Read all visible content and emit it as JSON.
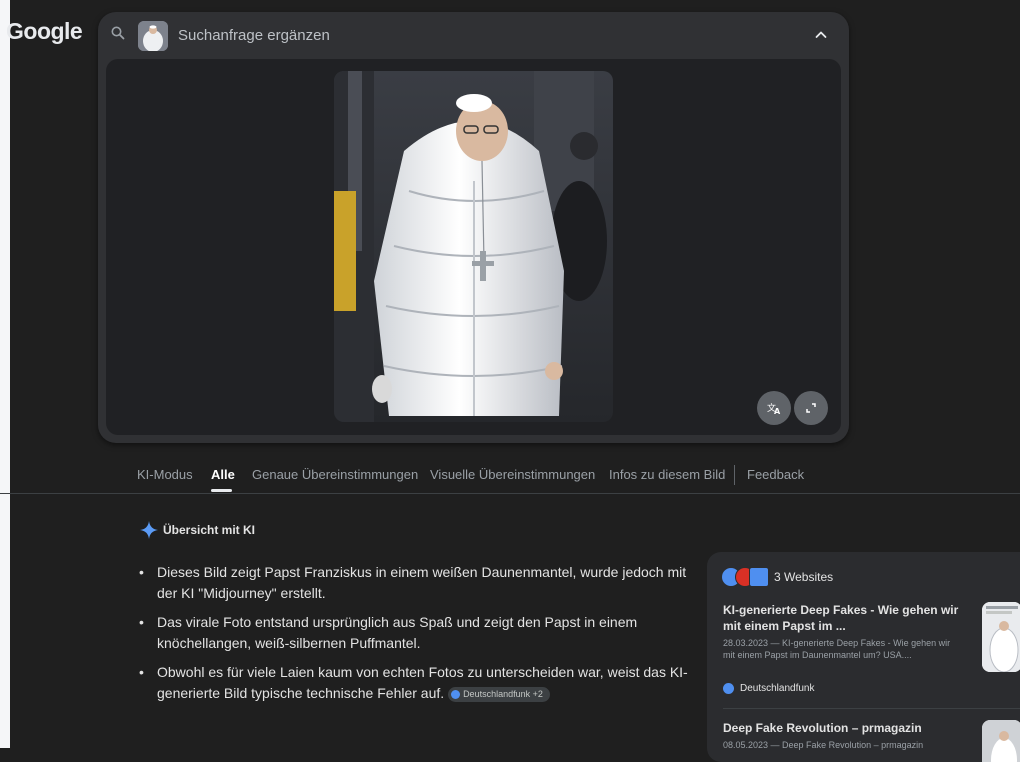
{
  "logo": "Google",
  "search": {
    "placeholder": "Suchanfrage ergänzen"
  },
  "tabs": [
    {
      "label": "KI-Modus"
    },
    {
      "label": "Alle"
    },
    {
      "label": "Genaue Übereinstimmungen"
    },
    {
      "label": "Visuelle Übereinstimmungen"
    },
    {
      "label": "Infos zu diesem Bild"
    },
    {
      "label": "Feedback"
    }
  ],
  "active_tab": "Alle",
  "ai_overview": {
    "title": "Übersicht mit KI",
    "bullets": [
      "Dieses Bild zeigt Papst Franziskus in einem weißen Daunenmantel, wurde jedoch mit der KI \"Midjourney\" erstellt.",
      "Das virale Foto entstand ursprünglich aus Spaß und zeigt den Papst in einem knöchellangen, weiß-silbernen Puffmantel.",
      "Obwohl es für viele Laien kaum von echten Fotos zu unterscheiden war, weist das KI-generierte Bild typische technische Fehler auf."
    ],
    "source_chip": "Deutschlandfunk +2"
  },
  "sources": {
    "count_label": "3 Websites",
    "items": [
      {
        "title": "KI-generierte Deep Fakes - Wie gehen wir mit einem Papst im ...",
        "snippet": "28.03.2023 — KI-generierte Deep Fakes - Wie gehen wir mit einem Papst im Daunenmantel um? USA....",
        "publisher": "Deutschlandfunk"
      },
      {
        "title": "Deep Fake Revolution – prmagazin",
        "snippet": "08.05.2023 — Deep Fake Revolution – prmagazin"
      }
    ]
  },
  "colors": {
    "background": "#1f1f1f",
    "card": "#303134",
    "accent_blue": "#4f8ff0"
  }
}
